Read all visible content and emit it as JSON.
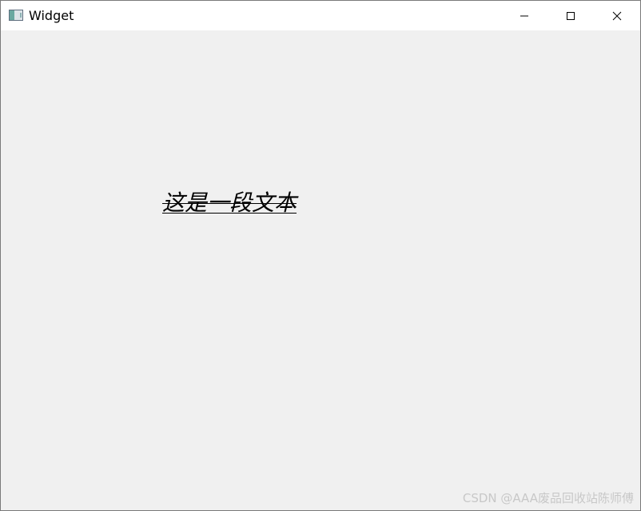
{
  "window": {
    "title": "Widget",
    "app_icon": "window-app-icon",
    "caption_buttons": {
      "minimize": "minimize-icon",
      "maximize": "maximize-icon",
      "close": "close-icon"
    }
  },
  "content": {
    "text": "这是一段文本",
    "watermark": "CSDN @AAA废品回收站陈师傅"
  },
  "colors": {
    "titlebar_background": "#ffffff",
    "client_background": "#f0f0f0",
    "text": "#000000",
    "watermark": "#c8c8c8"
  }
}
